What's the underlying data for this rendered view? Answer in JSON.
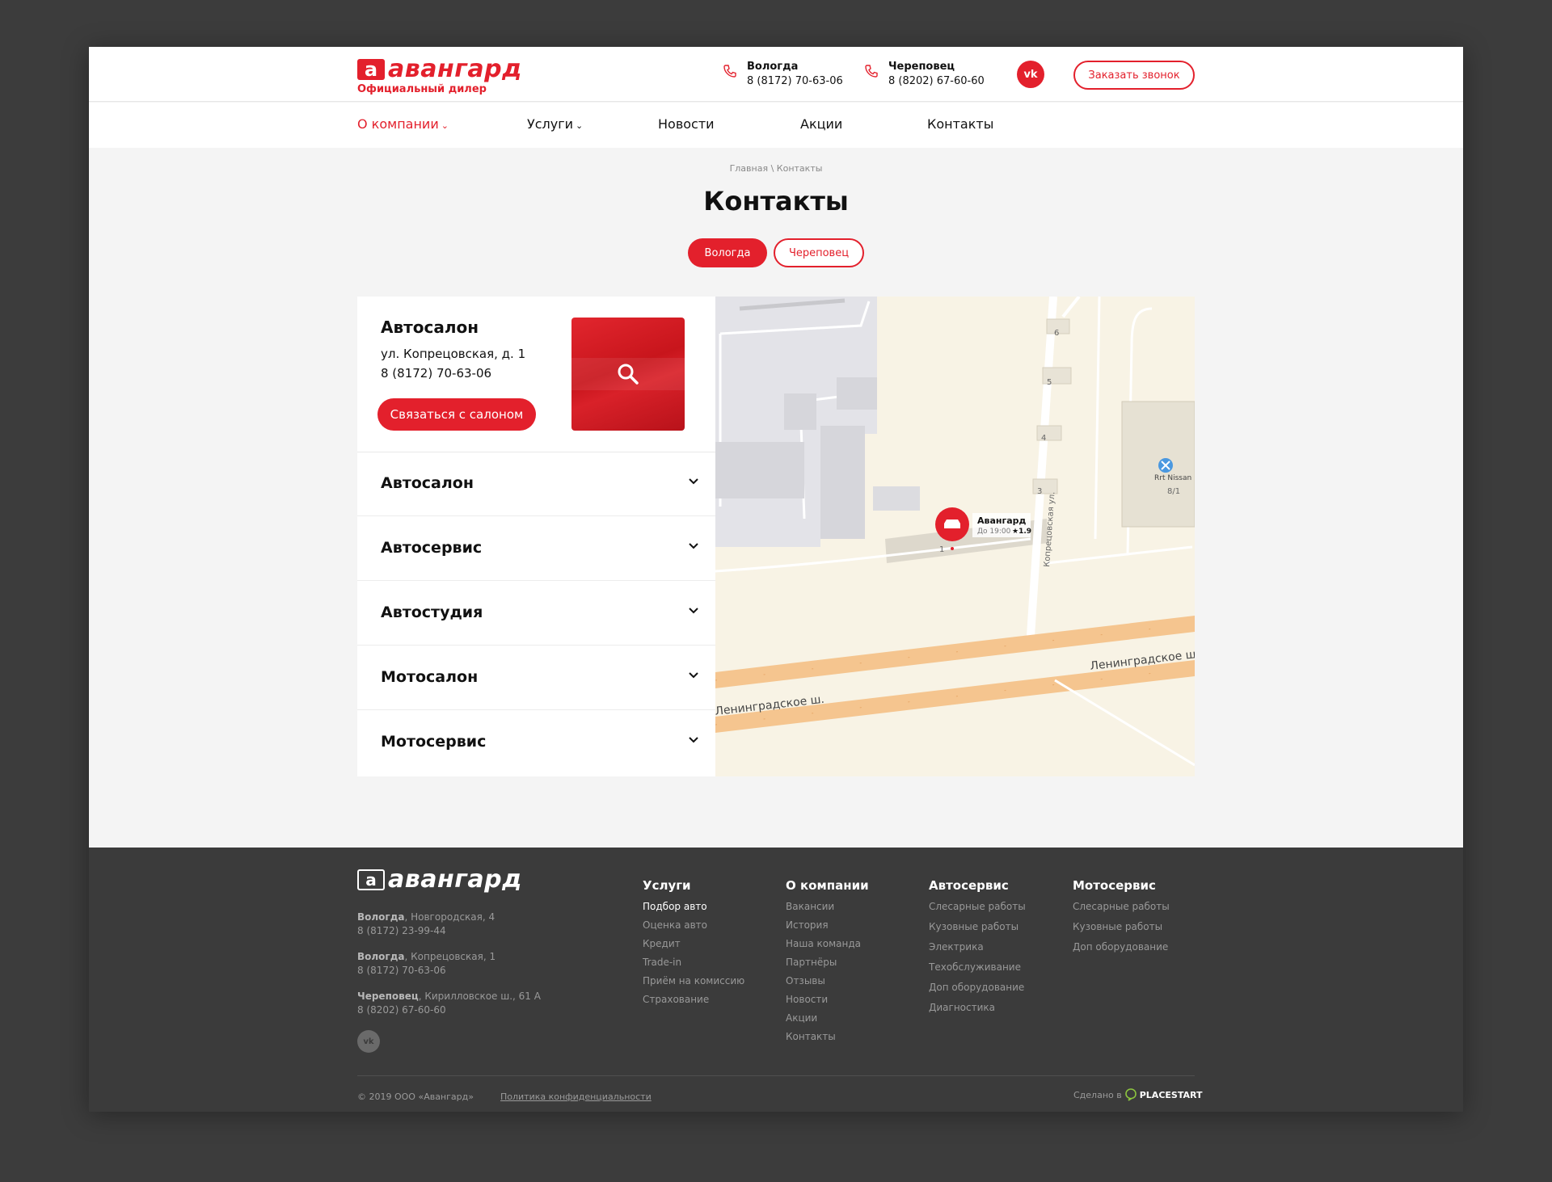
{
  "header": {
    "logo_mark": "а",
    "logo_text": "авангард",
    "logo_sub": "Официальный дилер",
    "phones": [
      {
        "city": "Вологда",
        "number": "8 (8172) 70-63-06"
      },
      {
        "city": "Череповец",
        "number": "8 (8202) 67-60-60"
      }
    ],
    "vk": "vk",
    "callback": "Заказать звонок"
  },
  "nav": [
    {
      "label": "О компании",
      "chevron": "⌄"
    },
    {
      "label": "Услуги",
      "chevron": "⌄"
    },
    {
      "label": "Новости"
    },
    {
      "label": "Акции"
    },
    {
      "label": "Контакты"
    }
  ],
  "breadcrumb": {
    "home": "Главная",
    "sep": "\\",
    "current": "Контакты"
  },
  "page_title": "Контакты",
  "city_tabs": [
    "Вологда",
    "Череповец"
  ],
  "card": {
    "title": "Автосалон",
    "address": "ул. Копрецовская, д. 1",
    "phone": "8 (8172) 70-63-06",
    "button": "Связаться с салоном"
  },
  "accordion": [
    "Автосалон",
    "Автосервис",
    "Автостудия",
    "Мотосалон",
    "Мотосервис"
  ],
  "map": {
    "street_vertical": "Копрецовская ул.",
    "street_main_left": "Ленинградское ш.",
    "street_main_right": "Ленинградское ш",
    "house_numbers": [
      "6",
      "5",
      "4",
      "3",
      "1"
    ],
    "poi_name": "Rrt Nissan",
    "poi_number": "8/1",
    "marker_name": "Авангард",
    "marker_hours": "До 19:00",
    "marker_rating": "★1.9"
  },
  "footer": {
    "logo_mark": "а",
    "logo_text": "авангард",
    "addresses": [
      {
        "city": "Вологда",
        "street": ", Новгородская, 4",
        "phone": "8 (8172) 23-99-44"
      },
      {
        "city": "Вологда",
        "street": ", Копрецовская, 1",
        "phone": "8 (8172) 70-63-06"
      },
      {
        "city": "Череповец",
        "street": ", Кирилловское ш., 61 А",
        "phone": "8 (8202) 67-60-60"
      }
    ],
    "vk": "vk",
    "columns": [
      {
        "title": "Услуги",
        "links": [
          "Подбор авто",
          "Оценка авто",
          "Кредит",
          "Trade-in",
          "Приём на комиссию",
          "Страхование"
        ]
      },
      {
        "title": "О компании",
        "links": [
          "Вакансии",
          "История",
          "Наша команда",
          "Партнёры",
          "Отзывы",
          "Новости",
          "Акции",
          "Контакты"
        ]
      },
      {
        "title": "Автосервис",
        "links": [
          "Слесарные работы",
          "Кузовные работы",
          "Электрика",
          "Техобслуживание",
          "Доп оборудование",
          "Диагностика"
        ]
      },
      {
        "title": "Мотосервис",
        "links": [
          "Слесарные работы",
          "Кузовные работы",
          "Доп оборудование"
        ]
      }
    ],
    "copyright": "© 2019 ООО «Авангард»",
    "policy": "Политика конфиденциальности",
    "made_in": "Сделано в",
    "made_brand": "PLACESTART"
  },
  "colors": {
    "accent": "#e3202c",
    "footer_bg": "#3b3b3b",
    "page_bg": "#f4f4f4"
  }
}
